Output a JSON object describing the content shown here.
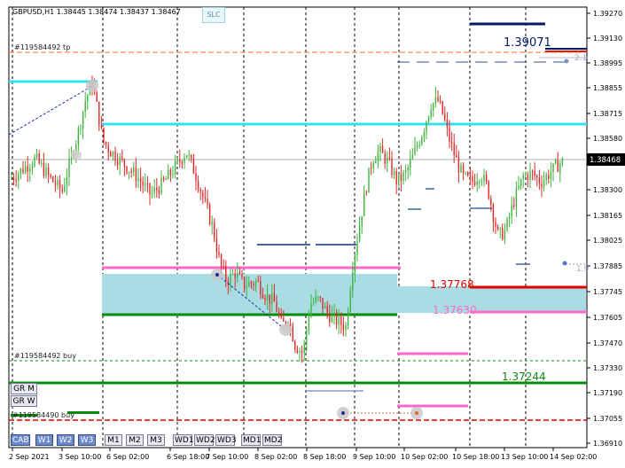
{
  "symbol_info": "GBPUSD,H1  1.38445  1.38474  1.38437  1.38467",
  "slc_button": "SLC",
  "price_axis_labels": [
    "1.39270",
    "1.39130",
    "1.38995",
    "1.38855",
    "1.38715",
    "1.38580",
    "1.38440",
    "1.38300",
    "1.38165",
    "1.38025",
    "1.37885",
    "1.37745",
    "1.37605",
    "1.37470",
    "1.37330",
    "1.37190",
    "1.37055",
    "1.36910"
  ],
  "current_price_label": "1.38468",
  "time_axis_labels": [
    "2 Sep 2021",
    "3 Sep 10:00",
    "6 Sep 02:00",
    "6 Sep 18:00",
    "7 Sep 10:00",
    "8 Sep 02:00",
    "8 Sep 18:00",
    "9 Sep 10:00",
    "10 Sep 02:00",
    "10 Sep 18:00",
    "13 Sep 10:00",
    "14 Sep 02:00"
  ],
  "order_labels": {
    "tp": "#119584492 tp",
    "buy_upper": "#119584492 buy",
    "buy_lower": "#119584490 buy",
    "level_39071": "1.39071",
    "level_37768": "1.37768",
    "level_37630": "1.37630",
    "level_37244": "1.37244",
    "small_2_1": "2.1",
    "small_1_9": "1.9"
  },
  "buttons": {
    "gr_m": "GR M",
    "gr_w": "GR W",
    "cab": "CAB",
    "w1": "W1",
    "w2": "W2",
    "w3": "W3",
    "m1": "M1",
    "m2": "M2",
    "m3": "M3",
    "wd1": "WD1",
    "wd2": "WD2",
    "wd3": "WD3",
    "md1": "MD1",
    "md2": "MD2"
  },
  "colors": {
    "bull": "#3cb43c",
    "bear": "#e02828",
    "cyan": "#33e0f0",
    "pink": "#ff69c8",
    "green": "#0a8a0a",
    "red": "#e00000",
    "navy": "#001a66",
    "orange": "#ff6a2a",
    "zone": "#a9dde3"
  },
  "chart_data": {
    "type": "candlestick",
    "symbol": "GBPUSD",
    "timeframe": "H1",
    "ylim": [
      1.3688,
      1.3932
    ],
    "grid": true,
    "path": [
      [
        0,
        1.384
      ],
      [
        12,
        1.3837
      ],
      [
        25,
        1.3842
      ],
      [
        40,
        1.3848
      ],
      [
        55,
        1.3838
      ],
      [
        70,
        1.383
      ],
      [
        80,
        1.3848
      ],
      [
        88,
        1.3862
      ],
      [
        96,
        1.388
      ],
      [
        104,
        1.389
      ],
      [
        110,
        1.3875
      ],
      [
        116,
        1.3858
      ],
      [
        125,
        1.3852
      ],
      [
        140,
        1.3845
      ],
      [
        155,
        1.3838
      ],
      [
        170,
        1.3828
      ],
      [
        185,
        1.3835
      ],
      [
        200,
        1.3845
      ],
      [
        210,
        1.3852
      ],
      [
        220,
        1.384
      ],
      [
        230,
        1.3825
      ],
      [
        240,
        1.381
      ],
      [
        248,
        1.379
      ],
      [
        256,
        1.378
      ],
      [
        265,
        1.3785
      ],
      [
        275,
        1.3778
      ],
      [
        290,
        1.378
      ],
      [
        300,
        1.3772
      ],
      [
        310,
        1.3768
      ],
      [
        318,
        1.3755
      ],
      [
        325,
        1.376
      ],
      [
        333,
        1.3745
      ],
      [
        342,
        1.374
      ],
      [
        350,
        1.3768
      ],
      [
        360,
        1.377
      ],
      [
        370,
        1.3762
      ],
      [
        380,
        1.3758
      ],
      [
        390,
        1.3755
      ],
      [
        398,
        1.379
      ],
      [
        405,
        1.381
      ],
      [
        412,
        1.383
      ],
      [
        420,
        1.3848
      ],
      [
        428,
        1.3852
      ],
      [
        438,
        1.3846
      ],
      [
        448,
        1.3835
      ],
      [
        458,
        1.384
      ],
      [
        468,
        1.3852
      ],
      [
        478,
        1.3865
      ],
      [
        486,
        1.3878
      ],
      [
        494,
        1.388
      ],
      [
        500,
        1.3872
      ],
      [
        506,
        1.386
      ],
      [
        514,
        1.3848
      ],
      [
        522,
        1.3838
      ],
      [
        532,
        1.3835
      ],
      [
        542,
        1.384
      ],
      [
        550,
        1.3832
      ],
      [
        556,
        1.3818
      ],
      [
        562,
        1.3805
      ],
      [
        570,
        1.3808
      ],
      [
        580,
        1.3825
      ],
      [
        590,
        1.3838
      ],
      [
        600,
        1.384
      ],
      [
        610,
        1.3835
      ],
      [
        620,
        1.384
      ],
      [
        630,
        1.3845
      ],
      [
        637,
        1.3847
      ]
    ],
    "horizontal_levels": [
      {
        "price": 1.39071,
        "label": "1.39071",
        "color": "navy"
      },
      {
        "price": 1.37768,
        "label": "1.37768",
        "color": "red"
      },
      {
        "price": 1.3763,
        "label": "1.37630",
        "color": "pink"
      },
      {
        "price": 1.37244,
        "label": "1.37244",
        "color": "green"
      }
    ],
    "current_price": 1.38468
  }
}
